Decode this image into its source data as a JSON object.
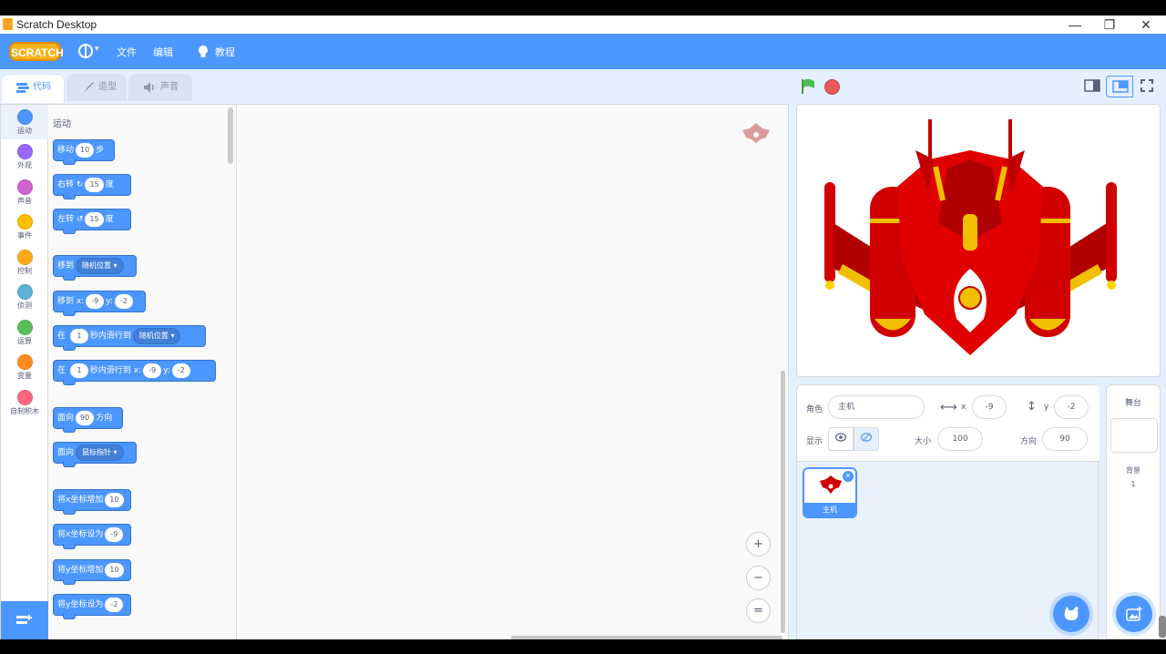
{
  "window": {
    "title": "Scratch Desktop",
    "minimize": "—",
    "maximize": "❐",
    "close": "✕"
  },
  "menubar": {
    "logo": "SCRATCH",
    "file": "文件",
    "edit": "编辑",
    "tutorials": "教程",
    "globe_caret": "▾"
  },
  "tabs": {
    "code": "代码",
    "costumes": "造型",
    "sounds": "声音"
  },
  "categories": [
    {
      "label": "运动",
      "color": "#4c97ff"
    },
    {
      "label": "外观",
      "color": "#9966ff"
    },
    {
      "label": "声音",
      "color": "#cf63cf"
    },
    {
      "label": "事件",
      "color": "#ffbf00"
    },
    {
      "label": "控制",
      "color": "#ffab19"
    },
    {
      "label": "侦测",
      "color": "#5cb1d6"
    },
    {
      "label": "运算",
      "color": "#59c059"
    },
    {
      "label": "变量",
      "color": "#ff8c1a"
    },
    {
      "label": "自制积木",
      "color": "#ff6680"
    }
  ],
  "palette": {
    "title": "运动",
    "move": {
      "a": "移动",
      "v": "10",
      "b": "步"
    },
    "turn_right": {
      "a": "右转",
      "v": "15",
      "b": "度"
    },
    "turn_left": {
      "a": "左转",
      "v": "15",
      "b": "度"
    },
    "goto": {
      "a": "移到",
      "d": "随机位置"
    },
    "goto_xy": {
      "a": "移到 x:",
      "x": "-9",
      "b": "y:",
      "y": "-2"
    },
    "glide": {
      "a": "在",
      "v": "1",
      "b": "秒内滑行到",
      "d": "随机位置"
    },
    "glide_xy": {
      "a": "在",
      "v": "1",
      "b": "秒内滑行到 x:",
      "x": "-9",
      "c": "y:",
      "y": "-2"
    },
    "point_dir": {
      "a": "面向",
      "v": "90",
      "b": "方向"
    },
    "point_towards": {
      "a": "面向",
      "d": "鼠标指针"
    },
    "change_x": {
      "a": "将x坐标增加",
      "v": "10"
    },
    "set_x": {
      "a": "将x坐标设为",
      "v": "-9"
    },
    "change_y": {
      "a": "将y坐标增加",
      "v": "10"
    },
    "set_y": {
      "a": "将y坐标设为",
      "v": "-2"
    }
  },
  "zoom": {
    "in": "+",
    "out": "−",
    "reset": "="
  },
  "sprite_info": {
    "sprite_label": "角色",
    "sprite_name": "主机",
    "x_label": "x",
    "x_value": "-9",
    "y_label": "y",
    "y_value": "-2",
    "show_label": "显示",
    "size_label": "大小",
    "size_value": "100",
    "direction_label": "方向",
    "direction_value": "90"
  },
  "sprites": [
    {
      "name": "主机"
    }
  ],
  "stage_panel": {
    "title": "舞台",
    "backdrops_label": "背景",
    "backdrops_count": "1"
  },
  "colors": {
    "accent": "#4c97ff",
    "flag": "#4cbf56",
    "stop": "#ec5959"
  }
}
